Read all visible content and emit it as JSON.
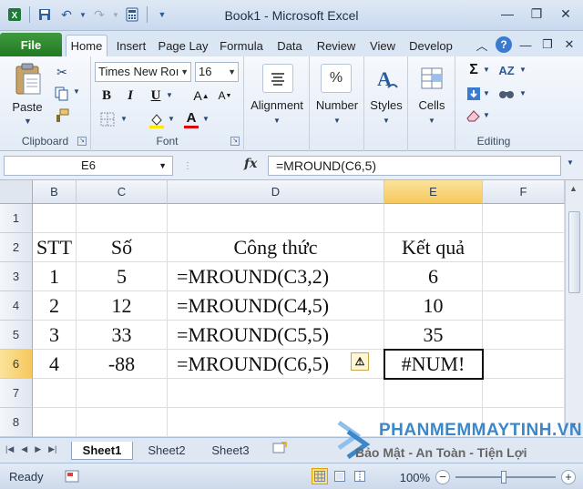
{
  "window": {
    "title": "Book1 - Microsoft Excel"
  },
  "ribbon_tabs": {
    "file": "File",
    "home": "Home",
    "insert": "Insert",
    "page_layout": "Page Lay",
    "formulas": "Formula",
    "data": "Data",
    "review": "Review",
    "view": "View",
    "developer": "Develop"
  },
  "ribbon": {
    "clipboard": {
      "paste": "Paste",
      "label": "Clipboard"
    },
    "font": {
      "name": "Times New Roı",
      "size": "16",
      "label": "Font"
    },
    "alignment": {
      "label": "Alignment"
    },
    "number": {
      "label": "Number",
      "icon_text": "%"
    },
    "styles": {
      "label": "Styles"
    },
    "cells": {
      "label": "Cells"
    },
    "editing": {
      "label": "Editing"
    }
  },
  "formula_bar": {
    "name_box": "E6",
    "fx": "fx",
    "formula": "=MROUND(C6,5)"
  },
  "grid": {
    "columns": [
      "B",
      "C",
      "D",
      "E",
      "F"
    ],
    "selected_column": "E",
    "rows": [
      "1",
      "2",
      "3",
      "4",
      "5",
      "6",
      "7",
      "8"
    ],
    "selected_row": "6",
    "header_row": {
      "stt": "STT",
      "so": "Số",
      "formula": "Công thức",
      "result": "Kết quả"
    },
    "data_rows": [
      {
        "stt": "1",
        "so": "5",
        "formula": "=MROUND(C3,2)",
        "result": "6"
      },
      {
        "stt": "2",
        "so": "12",
        "formula": "=MROUND(C4,5)",
        "result": "10"
      },
      {
        "stt": "3",
        "so": "33",
        "formula": "=MROUND(C5,5)",
        "result": "35"
      },
      {
        "stt": "4",
        "so": "-88",
        "formula": "=MROUND(C6,5)",
        "result": "#NUM!"
      }
    ]
  },
  "sheets": {
    "tabs": [
      "Sheet1",
      "Sheet2",
      "Sheet3"
    ],
    "active": "Sheet1"
  },
  "status_bar": {
    "status": "Ready",
    "zoom": "100%"
  },
  "watermark": {
    "brand": "PHANMEMMAYTINH.VN",
    "tagline": "Bảo Mật - An Toàn - Tiện Lợi"
  },
  "colors": {
    "file_tab": "#227a22",
    "selected_header": "#f6c85c",
    "watermark_blue": "#3a87c9"
  }
}
